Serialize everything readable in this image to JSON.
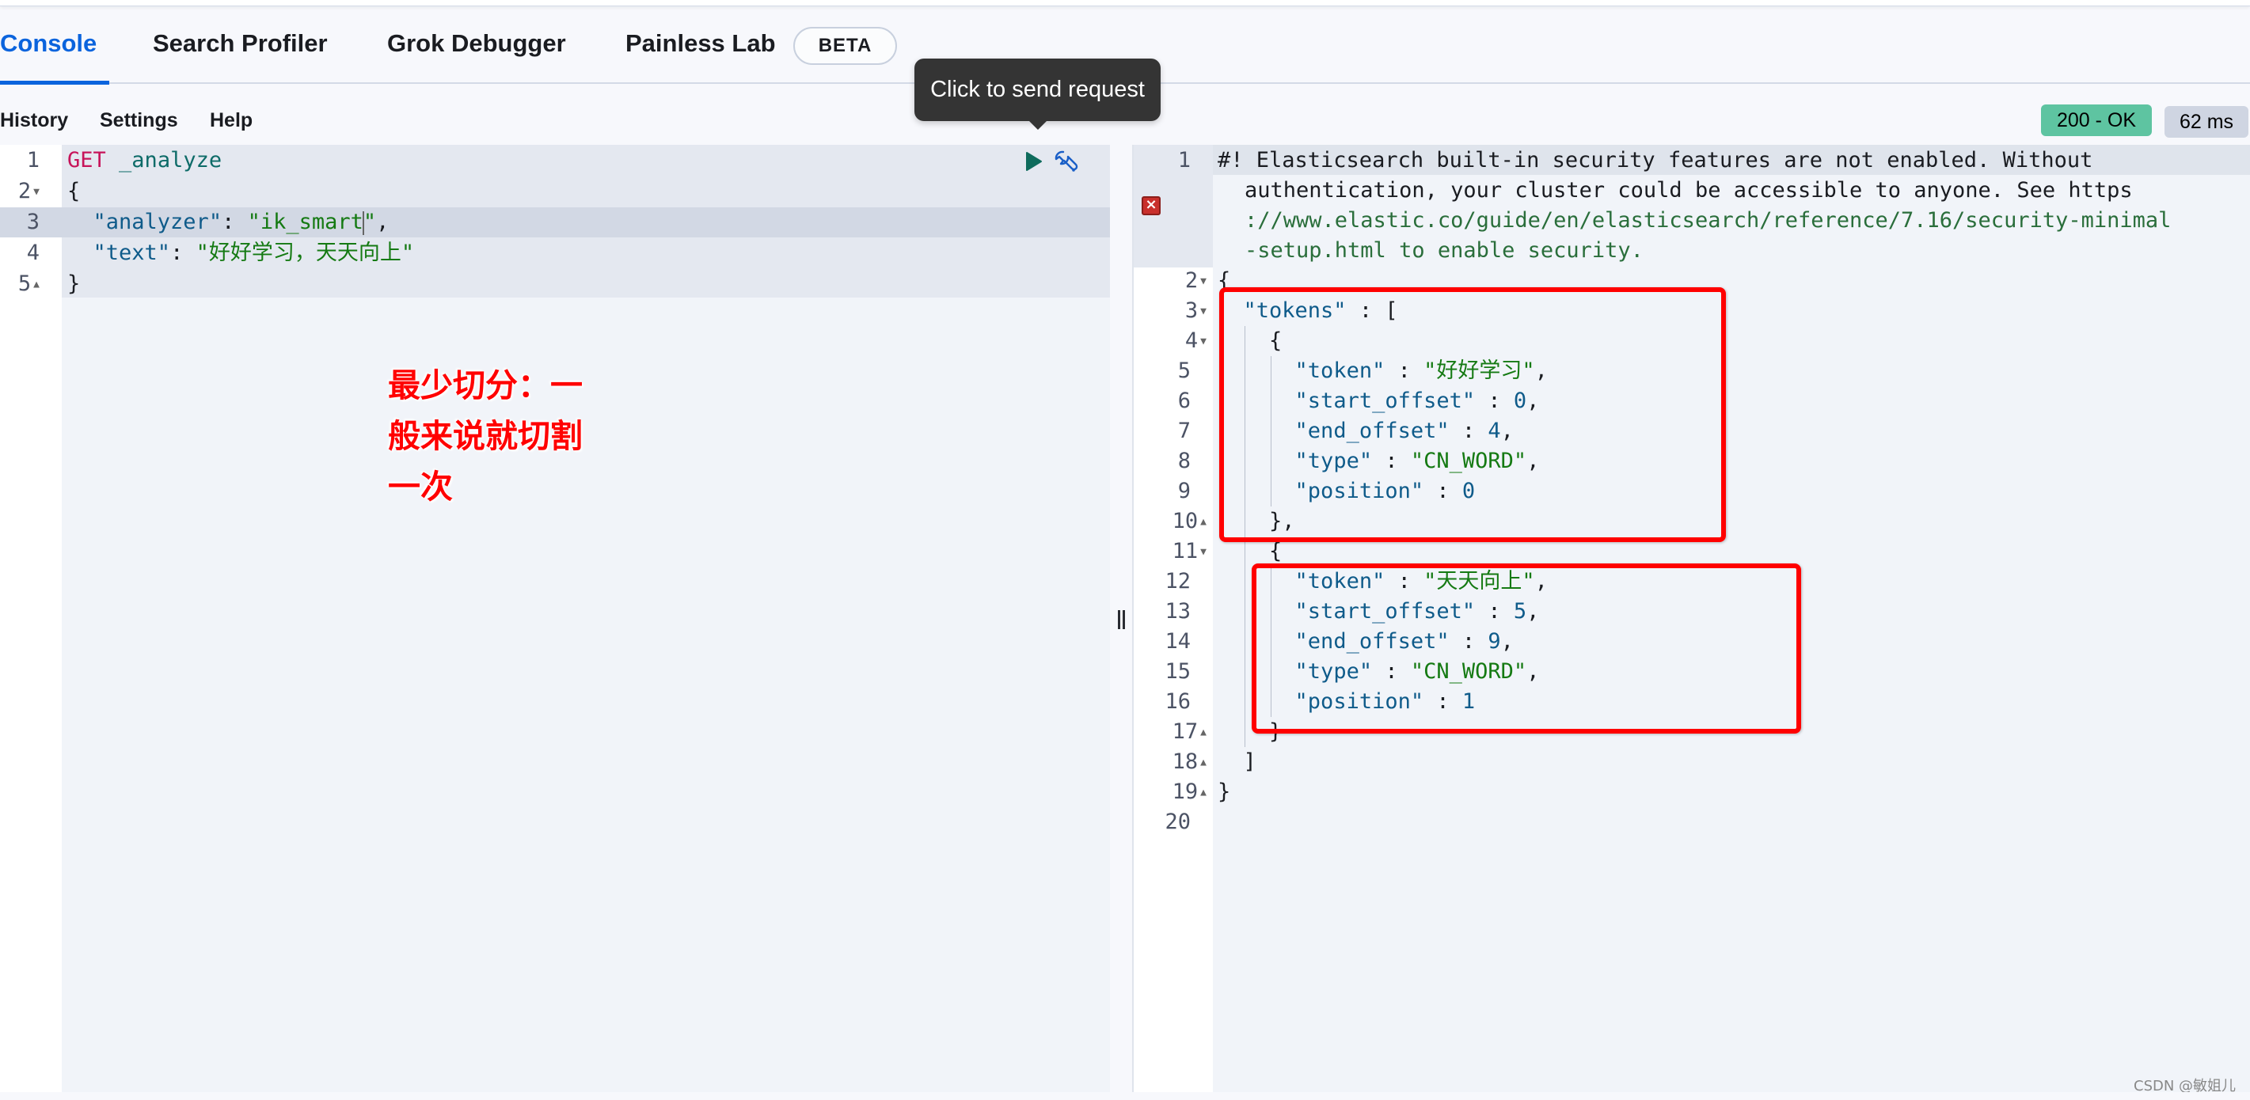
{
  "tabs": [
    {
      "label": "Console",
      "active": true
    },
    {
      "label": "Search Profiler",
      "active": false
    },
    {
      "label": "Grok Debugger",
      "active": false
    },
    {
      "label": "Painless Lab",
      "active": false
    }
  ],
  "beta_badge": "BETA",
  "toolbar": {
    "menu": [
      "History",
      "Settings",
      "Help"
    ],
    "status": "200 - OK",
    "time": "62 ms"
  },
  "tooltip": "Click to send request",
  "request_editor": {
    "line_numbers": [
      "1",
      "2",
      "3",
      "4",
      "5"
    ],
    "method": "GET",
    "url": "_analyze",
    "open_brace": "{",
    "analyzer_key": "\"analyzer\"",
    "analyzer_value": "\"ik_smart\"",
    "text_key": "\"text\"",
    "text_value": "\"好好学习，天天向上\"",
    "close_brace": "}",
    "colon": ": ",
    "comma": ","
  },
  "annotation": {
    "line1": "最少切分：一",
    "line2": "般来说就切割",
    "line3": "一次"
  },
  "response_editor": {
    "line_numbers": [
      "1",
      "2",
      "3",
      "4",
      "5",
      "6",
      "7",
      "8",
      "9",
      "10",
      "11",
      "12",
      "13",
      "14",
      "15",
      "16",
      "17",
      "18",
      "19",
      "20"
    ],
    "warning_lines": [
      "#! Elasticsearch built-in security features are not enabled. Without",
      "authentication, your cluster could be accessible to anyone. See https",
      "://www.elastic.co/guide/en/elasticsearch/reference/7.16/security-minimal",
      "-setup.html to enable security."
    ],
    "tokens_key": "\"tokens\"",
    "tokens": [
      {
        "token": "\"好好学习\"",
        "start_offset": "0",
        "end_offset": "4",
        "type": "\"CN_WORD\"",
        "position": "0"
      },
      {
        "token": "\"天天向上\"",
        "start_offset": "5",
        "end_offset": "9",
        "type": "\"CN_WORD\"",
        "position": "1"
      }
    ],
    "keys": {
      "token": "\"token\"",
      "start_offset": "\"start_offset\"",
      "end_offset": "\"end_offset\"",
      "type": "\"type\"",
      "position": "\"position\""
    }
  },
  "watermark": "CSDN @敏姐儿",
  "colors": {
    "accent": "#0b64dd",
    "status_ok": "#5ec4a1",
    "annotation_red": "#ff0000"
  }
}
